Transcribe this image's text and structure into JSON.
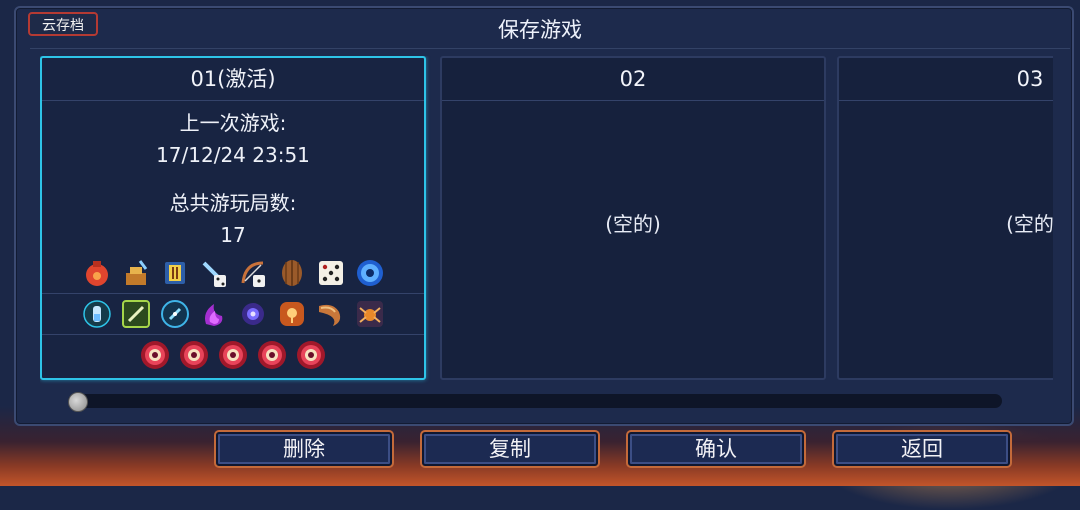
{
  "header": {
    "cloud_save": "云存档",
    "title": "保存游戏"
  },
  "slots": [
    {
      "label": "01(激活)",
      "active": true,
      "last_played_label": "上一次游戏:",
      "last_played": "17/12/24 23:51",
      "runs_label": "总共游玩局数:",
      "runs": "17",
      "items_row1": [
        "pouch-icon",
        "bomb-icon",
        "scroll-icon",
        "sword-dice-icon",
        "bow-dice-icon",
        "shield-icon",
        "dice-icon",
        "orb-icon"
      ],
      "items_row2": [
        "potion-icon",
        "wrench-icon",
        "compass-icon",
        "flame-icon",
        "rune-icon",
        "gem-icon",
        "horn-icon",
        "spider-icon"
      ],
      "items_row3": [
        "boss-cell-icon",
        "boss-cell-icon",
        "boss-cell-icon",
        "boss-cell-icon",
        "boss-cell-icon"
      ]
    },
    {
      "label": "02",
      "active": false,
      "empty_text": "(空的)"
    },
    {
      "label": "03",
      "active": false,
      "empty_text": "(空的"
    }
  ],
  "buttons": {
    "delete": "删除",
    "copy": "复制",
    "confirm": "确认",
    "back": "返回"
  },
  "colors": {
    "active_border": "#2ec4e8",
    "panel": "#1d2a4c",
    "accent": "#c46a3a"
  }
}
